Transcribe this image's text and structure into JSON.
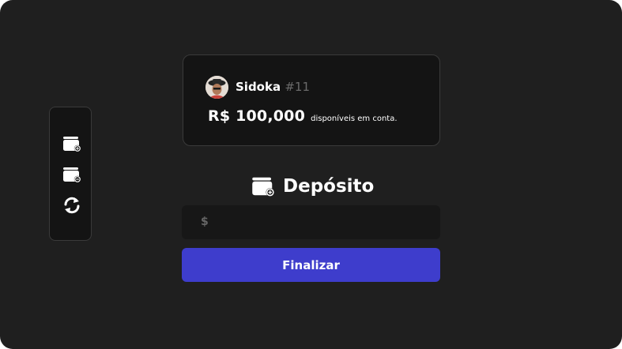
{
  "sidebar": {
    "items": [
      {
        "icon": "wallet-plus-icon",
        "action": "deposit"
      },
      {
        "icon": "wallet-minus-icon",
        "action": "withdraw"
      },
      {
        "icon": "transfer-arrows-icon",
        "action": "transfer"
      }
    ]
  },
  "account": {
    "username": "Sidoka",
    "user_id": "#11",
    "balance": "R$ 100,000",
    "balance_note": "disponíveis em conta."
  },
  "form": {
    "title": "Depósito",
    "title_icon": "wallet-plus-icon",
    "currency_symbol": "$",
    "amount_value": "",
    "submit_label": "Finalizar"
  },
  "colors": {
    "background": "#1f1f1f",
    "panel": "#141414",
    "accent": "#3e3dcc",
    "muted": "#6b6b6b"
  }
}
